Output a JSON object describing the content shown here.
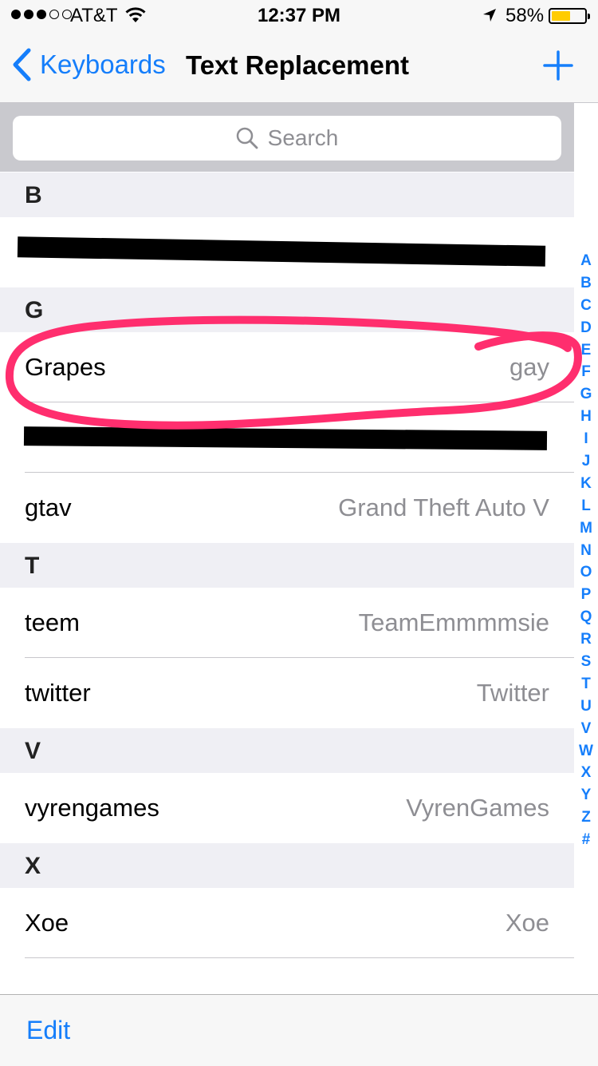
{
  "status_bar": {
    "carrier": "AT&T",
    "time": "12:37 PM",
    "battery_percent": "58%",
    "battery_level": 0.58,
    "signal_bars_filled": 3,
    "signal_bars_total": 5
  },
  "nav": {
    "back_label": "Keyboards",
    "title": "Text Replacement"
  },
  "search": {
    "placeholder": "Search"
  },
  "sections": [
    {
      "letter": "B",
      "rows": [
        {
          "phrase": "",
          "shortcut": "",
          "redacted": true
        }
      ]
    },
    {
      "letter": "G",
      "rows": [
        {
          "phrase": "Grapes",
          "shortcut": "gay"
        },
        {
          "phrase": "",
          "shortcut": "",
          "redacted": true
        },
        {
          "phrase": "gtav",
          "shortcut": "Grand Theft Auto V"
        }
      ]
    },
    {
      "letter": "T",
      "rows": [
        {
          "phrase": "teem",
          "shortcut": "TeamEmmmmsie"
        },
        {
          "phrase": "twitter",
          "shortcut": "Twitter"
        }
      ]
    },
    {
      "letter": "V",
      "rows": [
        {
          "phrase": "vyrengames",
          "shortcut": "VyrenGames"
        }
      ]
    },
    {
      "letter": "X",
      "rows": [
        {
          "phrase": "Xoe",
          "shortcut": "Xoe"
        }
      ]
    }
  ],
  "index_letters": [
    "A",
    "B",
    "C",
    "D",
    "E",
    "F",
    "G",
    "H",
    "I",
    "J",
    "K",
    "L",
    "M",
    "N",
    "O",
    "P",
    "Q",
    "R",
    "S",
    "T",
    "U",
    "V",
    "W",
    "X",
    "Y",
    "Z",
    "#"
  ],
  "toolbar": {
    "edit_label": "Edit"
  },
  "colors": {
    "accent": "#157efb",
    "annotation": "#ff2e6e",
    "redaction": "#000000",
    "battery": "#ffcc00"
  }
}
